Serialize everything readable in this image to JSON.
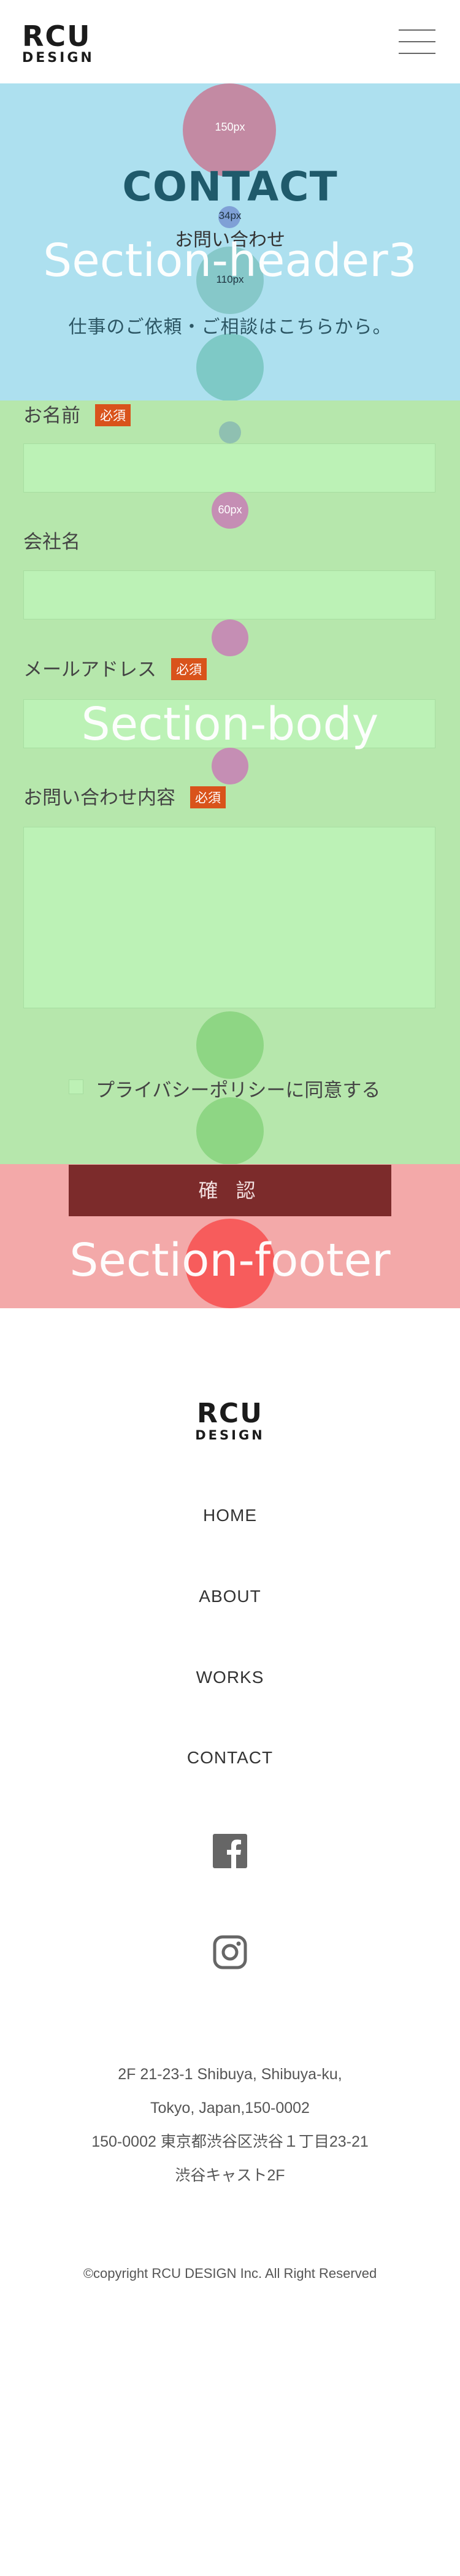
{
  "brand": {
    "line1": "RCU",
    "line2": "DESIGN"
  },
  "menu": {
    "icon": "hamburger-menu-icon"
  },
  "section_header": {
    "title": "CONTACT",
    "subtitle": "お問い合わせ",
    "description": "仕事のご依頼・ご相談はこちらから。",
    "label": "Section-header3",
    "spacing_notes": [
      "150px",
      "34px",
      "110px"
    ]
  },
  "section_body": {
    "label": "Section-body",
    "spacing_note": "60px",
    "fields": {
      "name": {
        "label": "お名前",
        "required": "必須",
        "value": ""
      },
      "company": {
        "label": "会社名",
        "value": ""
      },
      "email": {
        "label": "メールアドレス",
        "required": "必須",
        "value": ""
      },
      "inquiry": {
        "label": "お問い合わせ内容",
        "required": "必須",
        "value": ""
      }
    },
    "privacy": "プライバシーポリシーに同意する"
  },
  "section_footer": {
    "label": "Section-footer",
    "confirm_button": "確 認"
  },
  "footer": {
    "logo": {
      "line1": "RCU",
      "line2": "DESIGN"
    },
    "nav": [
      "HOME",
      "ABOUT",
      "WORKS",
      "CONTACT"
    ],
    "social": [
      "facebook-icon",
      "instagram-icon"
    ],
    "address": [
      "2F 21-23-1 Shibuya, Shibuya-ku,",
      "Tokyo, Japan,150-0002",
      "150-0002 東京都渋谷区渋谷１丁目23-21",
      "渋谷キャスト2F"
    ],
    "copyright": "©copyright RCU DESIGN Inc. All Right Reserved"
  },
  "colors": {
    "header_bg": "#ade0ef",
    "body_bg": "#b6e7ac",
    "footer_bg": "#f3a9a9",
    "accent": "#7c2b2b",
    "required_badge": "#d9531b"
  }
}
